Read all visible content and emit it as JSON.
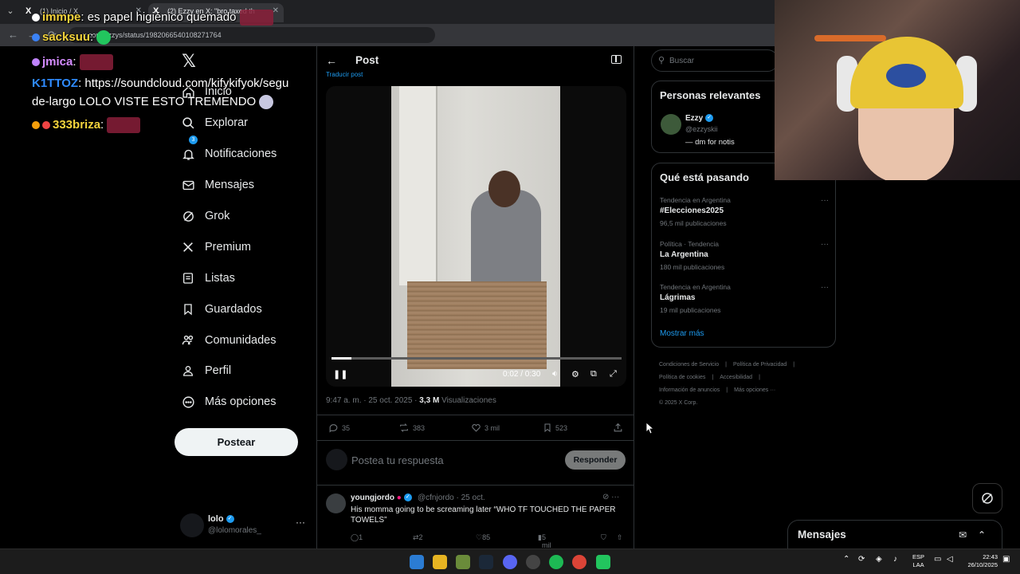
{
  "browser": {
    "tabs": [
      {
        "title": "(1) Inicio / X"
      },
      {
        "title": "(2) Ezzy en X: \"bro taxed th"
      }
    ],
    "url": "x.com/ezzys/status/1982066540108271764"
  },
  "sidebar": {
    "items": [
      {
        "label": "Inicio",
        "icon": "home-icon"
      },
      {
        "label": "Explorar",
        "icon": "search-icon"
      },
      {
        "label": "Notificaciones",
        "icon": "bell-icon",
        "badge": "3"
      },
      {
        "label": "Mensajes",
        "icon": "mail-icon"
      },
      {
        "label": "Grok",
        "icon": "grok-icon"
      },
      {
        "label": "Premium",
        "icon": "x-icon"
      },
      {
        "label": "Listas",
        "icon": "list-icon"
      },
      {
        "label": "Guardados",
        "icon": "bookmark-icon"
      },
      {
        "label": "Comunidades",
        "icon": "people-icon"
      },
      {
        "label": "Perfil",
        "icon": "person-icon"
      },
      {
        "label": "Más opciones",
        "icon": "more-circle-icon"
      }
    ],
    "post_button": "Postear",
    "account": {
      "name": "lolo",
      "handle": "@lolomorales_"
    }
  },
  "main": {
    "title": "Post",
    "translate": "Traducir post",
    "video": {
      "time": "0:02 / 0:30",
      "progress": 0.07
    },
    "meta": {
      "time": "9:47 a. m. · 25 oct. 2025 · ",
      "views": "3,3 M",
      "views_label": " Visualizaciones"
    },
    "actions": {
      "replies": "35",
      "reposts": "383",
      "likes": "3 mil",
      "bookmarks": "523"
    },
    "reply": {
      "placeholder": "Postea tu respuesta",
      "button": "Responder"
    },
    "comment": {
      "name": "youngjordo",
      "handle": "@cfnjordo · 25 oct.",
      "text": "His momma going to be screaming later “WHO TF TOUCHED THE PAPER TOWELS”",
      "replies": "1",
      "reposts": "2",
      "likes": "85",
      "views": "5 mil"
    }
  },
  "right": {
    "search_placeholder": "Buscar",
    "relevant": {
      "title": "Personas relevantes",
      "name": "Ezzy",
      "handle": "@ezzyskii",
      "bio": "— dm for notis"
    },
    "trends": {
      "title": "Qué está pasando",
      "items": [
        {
          "context": "Tendencia en Argentina",
          "name": "#Elecciones2025",
          "count": "96,5 mil publicaciones"
        },
        {
          "context": "Política · Tendencia",
          "name": "La Argentina",
          "count": "180 mil publicaciones"
        },
        {
          "context": "Tendencia en Argentina",
          "name": "Lágrimas",
          "count": "19 mil publicaciones"
        }
      ],
      "show_more": "Mostrar más"
    },
    "footer": {
      "terms": "Condiciones de Servicio",
      "privacy": "Política de Privacidad",
      "cookies": "Política de cookies",
      "accessibility": "Accesibilidad",
      "ads": "Información de anuncios",
      "more": "Más opciones ···",
      "copyright": "© 2025 X Corp."
    },
    "messages": "Mensajes"
  },
  "taskbar": {
    "lang_top": "ESP",
    "lang_bottom": "LAA",
    "time": "22:43",
    "date": "26/10/2025"
  },
  "chat_overlay": [
    {
      "user": "immpe",
      "message": ": es papel higiénico quemado",
      "color": "#f3d33c"
    },
    {
      "user": "sacksuu",
      "message": ":",
      "color": "#f3d33c"
    },
    {
      "user": "jmica",
      "message": ":",
      "color": "#d58cff"
    },
    {
      "user": "K1TTOZ",
      "message": ": https://soundcloud.com/kifykifyok/segu",
      "color": "#2f8bff"
    },
    {
      "user": "",
      "message": "de-largo LOLO VISTE ESTO TREMENDO",
      "color": "#ffffff"
    },
    {
      "user": "333briza",
      "message": ":",
      "color": "#f3d33c"
    }
  ]
}
